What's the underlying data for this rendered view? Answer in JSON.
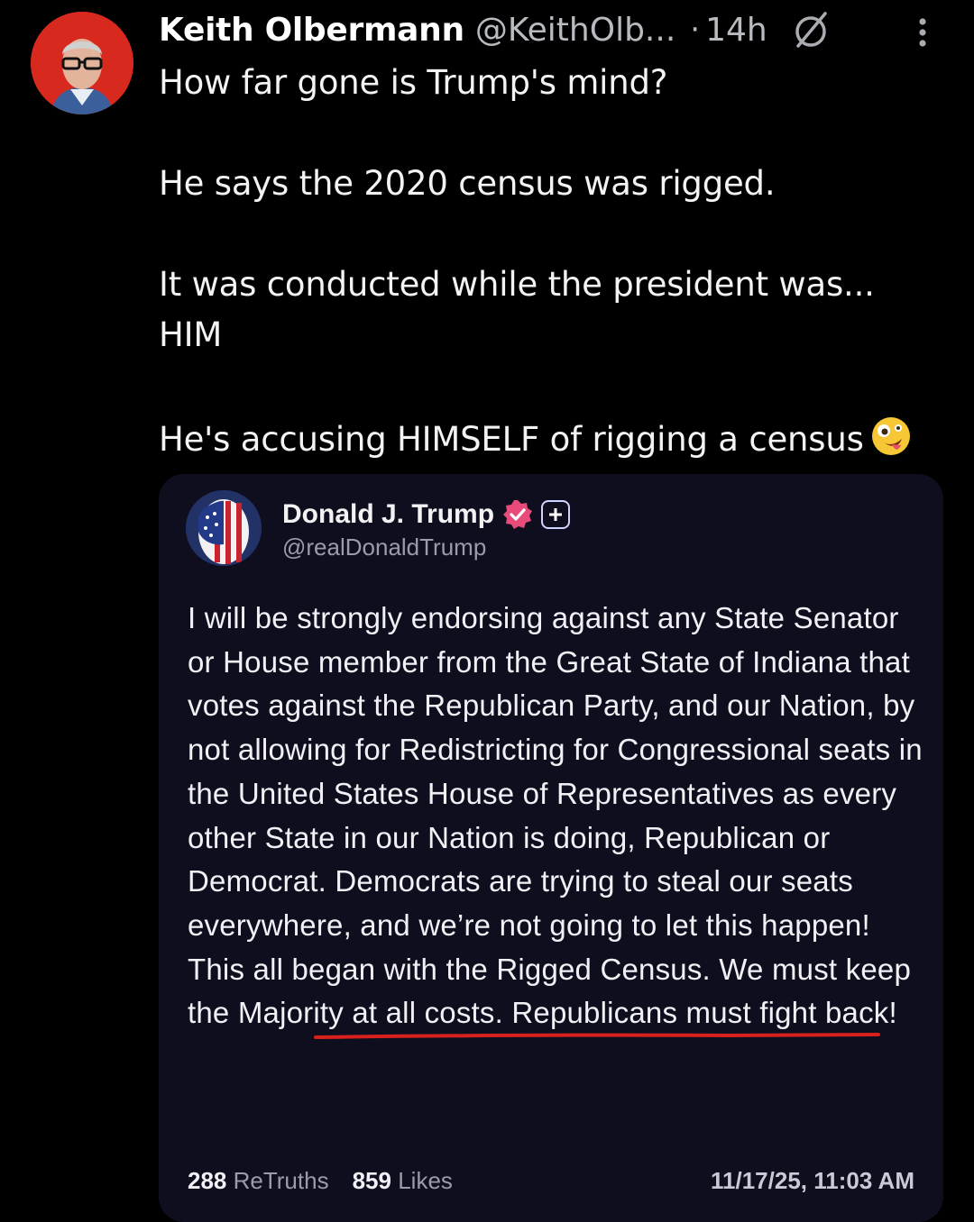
{
  "tweet": {
    "author_name": "Keith Olbermann",
    "author_handle": "@KeithOlb...",
    "separator": "·",
    "time_ago": "14h",
    "icons": {
      "grok": "grok-slash-icon",
      "more": "more-vertical-icon"
    },
    "lines": [
      "How far gone is Trump's mind?",
      "",
      "He says the 2020 census was rigged.",
      "",
      "It was conducted while the president was...",
      "HIM",
      "",
      "He's accusing HIMSELF of rigging a census"
    ],
    "emoji": "zany-face-emoji"
  },
  "quoted_post": {
    "author_name": "Donald J. Trump",
    "author_handle": "@realDonaldTrump",
    "verified_color": "#e84a7a",
    "text_before": "I will be strongly endorsing against any State Senator or House member from the Great State of Indiana that votes against the Republican Party, and our Nation, by not allowing for Redistricting for Congressional seats in the United States House of Representatives as every other State in our Nation is doing, Republican or Democrat. Democrats are trying to steal our seats everywhere, and we’re not going to let this happen! ",
    "text_underlined": "This all began with the Rigged Census.",
    "text_after": " We must keep the Majority at all costs. Republicans must fight back!",
    "underline_color": "#d8201c",
    "retruths_count": "288",
    "retruths_label": "ReTruths",
    "likes_count": "859",
    "likes_label": "Likes",
    "timestamp": "11/17/25, 11:03 AM"
  }
}
